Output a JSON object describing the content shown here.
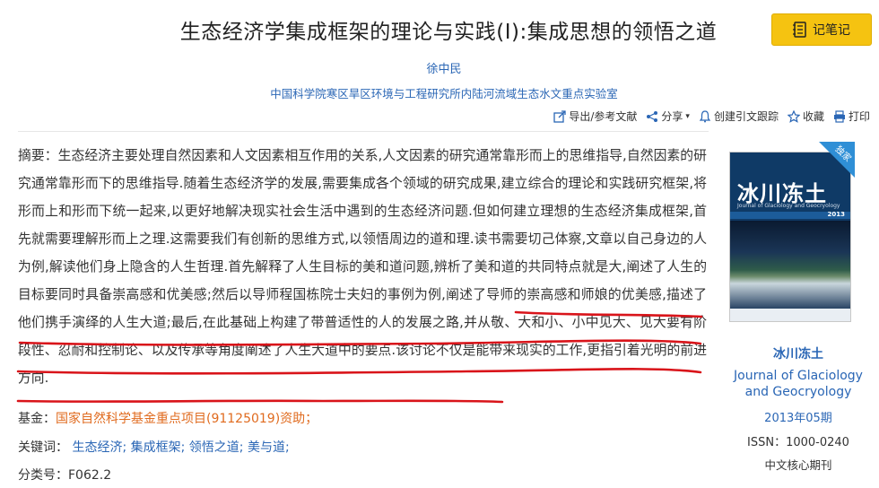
{
  "article": {
    "title": "生态经济学集成框架的理论与实践(I):集成思想的领悟之道",
    "author": "徐中民",
    "affiliation": "中国科学院寒区旱区环境与工程研究所内陆河流域生态水文重点实验室"
  },
  "note_button": {
    "label": "记笔记",
    "icon": "notebook-icon"
  },
  "toolbar": [
    {
      "label": "导出/参考文献",
      "icon": "export-icon"
    },
    {
      "label": "分享",
      "icon": "share-icon",
      "suffix": "▾"
    },
    {
      "label": "创建引文跟踪",
      "icon": "bell-icon"
    },
    {
      "label": "收藏",
      "icon": "star-icon"
    },
    {
      "label": "打印",
      "icon": "printer-icon"
    }
  ],
  "abstract": {
    "label": "摘要：",
    "text": "生态经济主要处理自然因素和人文因素相互作用的关系,人文因素的研究通常靠形而上的思维指导,自然因素的研究通常靠形而下的思维指导.随着生态经济学的发展,需要集成各个领域的研究成果,建立综合的理论和实践研究框架,将形而上和形而下统一起来,以更好地解决现实社会生活中遇到的生态经济问题.但如何建立理想的生态经济集成框架,首先就需要理解形而上之理.这需要我们有创新的思维方式,以领悟周边的道和理.读书需要切己体察,文章以自己身边的人为例,解读他们身上隐含的人生哲理.首先解释了人生目标的美和道问题,辨析了美和道的共同特点就是大,阐述了人生的目标要同时具备崇高感和优美感;然后以导师程国栋院士夫妇的事例为例,阐述了导师的崇高感和师娘的优美感,描述了他们携手演绎的人生大道;最后,在此基础上构建了带普适性的人的发展之路,并从敬、大和小、小中见大、见大要有阶段性、忍耐和控制论、以及传承等角度阐述了人生大道中的要点.该讨论不仅是能带来现实的工作,更指引着光明的前进方向."
  },
  "fund": {
    "label": "基金：",
    "value": "国家自然科学基金重点项目(91125019)资助；"
  },
  "keywords": {
    "label": "关键词：",
    "items": [
      "生态经济;",
      "集成框架;",
      "领悟之道;",
      "美与道;"
    ]
  },
  "classification": {
    "label": "分类号：",
    "value": "F062.2"
  },
  "journal": {
    "badge": "独家",
    "cover_title": "冰川冻土",
    "cover_subtitle": "Journal of Glaciology and Geocryology",
    "cover_year": "2013",
    "name_cn": "冰川冻土",
    "name_en": "Journal of Glaciology and Geocryology",
    "issue": "2013年05期",
    "issn": "ISSN：1000-0240",
    "core": "中文核心期刊"
  },
  "annotation": {
    "color": "#d9141a"
  }
}
